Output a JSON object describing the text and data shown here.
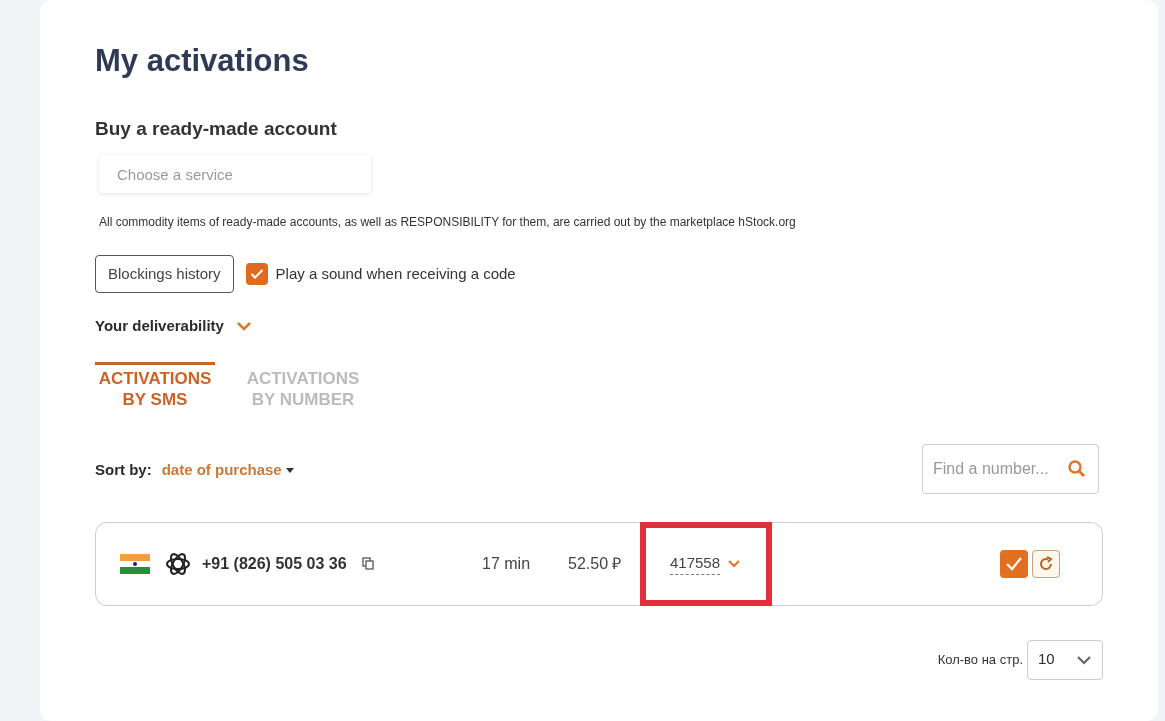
{
  "title": "My activations",
  "buy_account": {
    "heading": "Buy a ready-made account",
    "service_select": {
      "placeholder": "Choose a service"
    },
    "notice": "All commodity items of ready-made accounts, as well as RESPONSIBILITY for them, are carried out by the marketplace hStock.org"
  },
  "blockings_button": "Blockings history",
  "sound_option": {
    "label": "Play a sound when receiving a code",
    "checked": true
  },
  "deliverability": {
    "label": "Your deliverability",
    "expanded": false
  },
  "tabs": [
    {
      "label": "ACTIVATIONS BY SMS",
      "selected": true
    },
    {
      "label": "ACTIVATIONS BY NUMBER",
      "selected": false
    }
  ],
  "sort": {
    "label": "Sort by:",
    "value": "date of purchase"
  },
  "search": {
    "placeholder": "Find a number..."
  },
  "activations": [
    {
      "phone": "+91 (826) 505 03 36",
      "time": "17 min",
      "price": "52.50 ₽",
      "code": "417558",
      "highlighted": true,
      "done": true
    }
  ],
  "pagination": {
    "label": "Кол-во на стр.",
    "value": "10"
  }
}
